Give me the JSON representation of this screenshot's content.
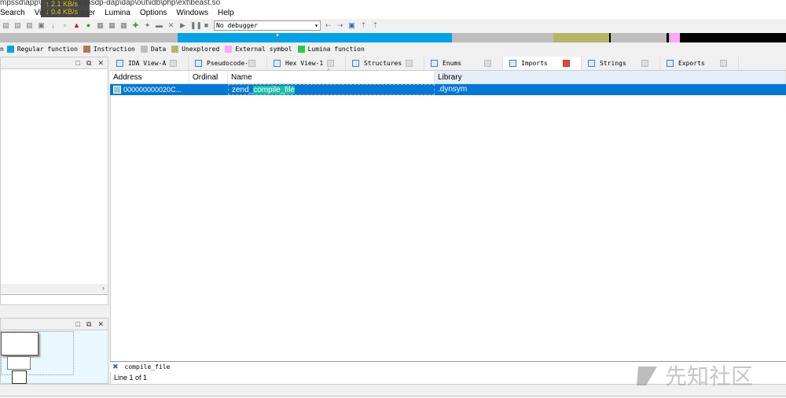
{
  "window": {
    "title": "mpssd\\app\\...\\docker-app\\sdp-dap\\dap\\out\\idb\\php\\ext\\beast.so"
  },
  "net_overlay": {
    "up": "↑ 2.1 KB/s",
    "down": "↓ 0.4 KB/s"
  },
  "menu": [
    "Search",
    "View",
    "Debugger",
    "Lumina",
    "Options",
    "Windows",
    "Help"
  ],
  "toolbar": {
    "debugger_select": "No debugger"
  },
  "legend": [
    {
      "label": "Regular function",
      "color": "#00a2e8"
    },
    {
      "label": "Instruction",
      "color": "#b0785a"
    },
    {
      "label": "Data",
      "color": "#bdbdbd"
    },
    {
      "label": "Unexplored",
      "color": "#b5b56a"
    },
    {
      "label": "External symbol",
      "color": "#ffa6ff"
    },
    {
      "label": "Lumina function",
      "color": "#2ec84a"
    }
  ],
  "legend_prefix": "n",
  "tabs": [
    {
      "label": "IDA View-A"
    },
    {
      "label": "Pseudocode-A"
    },
    {
      "label": "Hex View-1"
    },
    {
      "label": "Structures"
    },
    {
      "label": "Enums"
    },
    {
      "label": "Imports",
      "active": true
    },
    {
      "label": "Strings"
    },
    {
      "label": "Exports"
    }
  ],
  "table": {
    "columns": [
      "Address",
      "Ordinal",
      "Name",
      "Library"
    ],
    "rows": [
      {
        "address": "000000000020C...",
        "ordinal": "",
        "name_prefix": "zend_",
        "name_match": "compile_file",
        "library": ".dynsym"
      }
    ]
  },
  "filter": {
    "value": "compile_file"
  },
  "status": {
    "line": "Line 1 of 1"
  },
  "watermark": "先知社区"
}
